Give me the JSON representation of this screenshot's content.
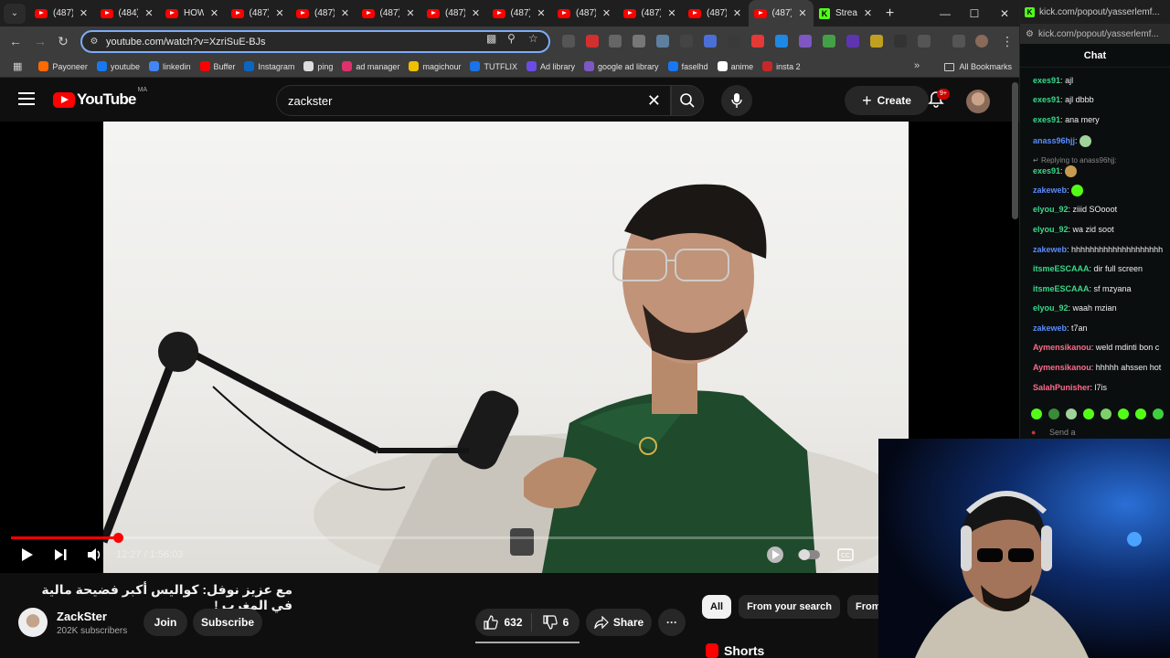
{
  "browser": {
    "tabs": [
      {
        "label": "(487)",
        "kind": "yt"
      },
      {
        "label": "(484)",
        "kind": "yt"
      },
      {
        "label": "HOW",
        "kind": "yt"
      },
      {
        "label": "(487)",
        "kind": "yt"
      },
      {
        "label": "(487)",
        "kind": "yt"
      },
      {
        "label": "(487)",
        "kind": "yt"
      },
      {
        "label": "(487)",
        "kind": "yt"
      },
      {
        "label": "(487)",
        "kind": "yt"
      },
      {
        "label": "(487)",
        "kind": "yt"
      },
      {
        "label": "(487)",
        "kind": "yt"
      },
      {
        "label": "(487)",
        "kind": "yt"
      },
      {
        "label": "(487)",
        "kind": "yt",
        "active": true
      },
      {
        "label": "Strea",
        "kind": "kick"
      }
    ],
    "url": "youtube.com/watch?v=XzriSuE-BJs",
    "bookmarks": [
      "Payoneer",
      "youtube",
      "linkedin",
      "Buffer",
      "Instagram",
      "ping",
      "ad manager",
      "magichour",
      "TUTFLIX",
      "Ad library",
      "google ad library",
      "faselhd",
      "anime",
      "insta 2"
    ],
    "all_bookmarks": "All Bookmarks",
    "extension_badges": [
      "5",
      "14"
    ]
  },
  "youtube": {
    "logo": "YouTube",
    "country": "MA",
    "search_value": "zackster",
    "create_label": "Create",
    "notif_badge": "9+",
    "player": {
      "time": "12:27 / 1:56:03",
      "progress_fraction": 0.107
    },
    "video_title": "مع عزيز نوفل: كواليس أكبر فضيحة مالية في المغرب !",
    "channel_name": "ZackSter",
    "subscribers": "202K subscribers",
    "join_label": "Join",
    "subscribe_label": "Subscribe",
    "likes": "632",
    "dislikes": "6",
    "share_label": "Share",
    "more_label": "···",
    "filters": [
      "All",
      "From your search",
      "From Z"
    ],
    "shorts_label": "Shorts"
  },
  "chat": {
    "tab_label": "Stre",
    "url": "kick.com/popout/yasserlemf...",
    "header": "Chat",
    "reply_note": "Replying to anass96hjj:",
    "send_placeholder": "Send a",
    "messages": [
      {
        "user": "exes91",
        "text": "ajl",
        "color": "#39d98a"
      },
      {
        "user": "exes91",
        "text": "ajl dbbb",
        "color": "#39d98a"
      },
      {
        "user": "exes91",
        "text": "ana mery",
        "color": "#39d98a"
      },
      {
        "user": "anass96hjj",
        "text": "",
        "color": "#5a8dff",
        "emote": "#9fd39a"
      },
      {
        "user": "exes91",
        "text": "",
        "color": "#39d98a",
        "emote": "#c89b52"
      },
      {
        "user": "zakeweb",
        "text": "",
        "color": "#5a8dff",
        "emote": "#53fc18"
      },
      {
        "user": "elyou_92",
        "text": "ziiid SOooot",
        "color": "#39d98a"
      },
      {
        "user": "elyou_92",
        "text": "wa zid soot",
        "color": "#39d98a"
      },
      {
        "user": "zakeweb",
        "text": "hhhhhhhhhhhhhhhhhhhh",
        "color": "#5a8dff"
      },
      {
        "user": "itsmeESCAAA",
        "text": "dir full screen",
        "color": "#39d98a"
      },
      {
        "user": "itsmeESCAAA",
        "text": "sf mzyana",
        "color": "#39d98a"
      },
      {
        "user": "elyou_92",
        "text": "waah mzian",
        "color": "#39d98a"
      },
      {
        "user": "zakeweb",
        "text": "t7an",
        "color": "#5a8dff"
      },
      {
        "user": "Aymensikanou",
        "text": "weld mdinti bon c",
        "color": "#ff6b8a"
      },
      {
        "user": "Aymensikanou",
        "text": "hhhhh ahssen hot",
        "color": "#ff6b8a"
      },
      {
        "user": "SalahPunisher",
        "text": "l7is",
        "color": "#ff6b8a"
      }
    ]
  },
  "colors": {
    "yt_red": "#ff0000",
    "kick_green": "#53fc18",
    "omnibox_focus": "#7cacf8"
  }
}
